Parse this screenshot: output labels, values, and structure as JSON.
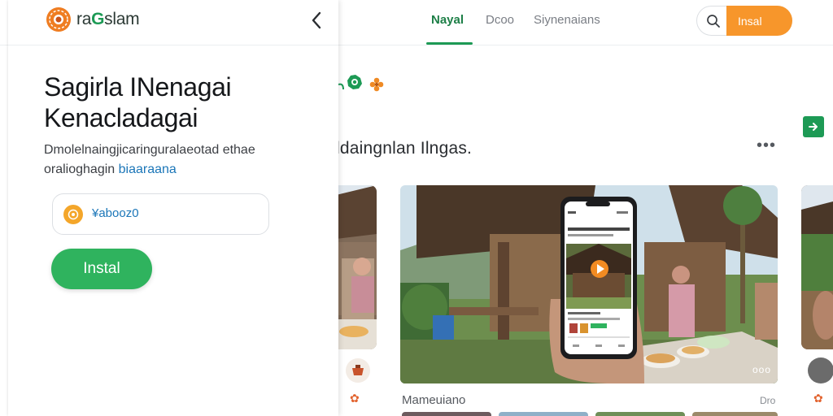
{
  "nav": {
    "tabs": [
      {
        "label": "Nayal",
        "active": true
      },
      {
        "label": "Dcoo",
        "active": false
      },
      {
        "label": "Siynenaians",
        "active": false
      }
    ],
    "search_icon": "search-icon",
    "install_label": "Insal"
  },
  "section": {
    "title": "ldaingnlan Ilngas.",
    "more_label": "•••"
  },
  "video": {
    "overlay_dots": "ooo",
    "play_icon": "play-icon"
  },
  "bottom": {
    "label": "Mameuiano",
    "meta": "Dro"
  },
  "panel": {
    "logo_prefix": "ra",
    "logo_accent": "G",
    "logo_suffix": "slam",
    "back_icon": "chevron-left-icon",
    "title_line1": "Sagirla INenagai",
    "title_line2": "Kenacladagai",
    "desc_line1": "Dmolelnaingjicaringuralaeotad ethae",
    "desc_line2_plain": "oralioghagin ",
    "desc_line2_link": "biaaraana",
    "code_value": "¥abooz0",
    "install_label": "Instal"
  },
  "colors": {
    "accent_green": "#2fb35e",
    "accent_orange": "#f7962b",
    "link_blue": "#1b76b8"
  }
}
